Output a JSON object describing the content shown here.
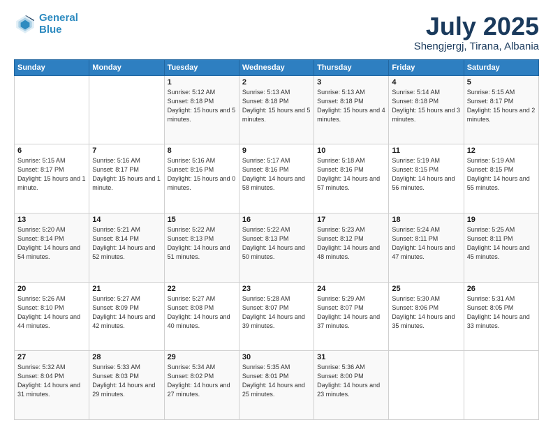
{
  "header": {
    "logo_line1": "General",
    "logo_line2": "Blue",
    "title": "July 2025",
    "subtitle": "Shengjergj, Tirana, Albania"
  },
  "days_of_week": [
    "Sunday",
    "Monday",
    "Tuesday",
    "Wednesday",
    "Thursday",
    "Friday",
    "Saturday"
  ],
  "weeks": [
    [
      {
        "num": "",
        "detail": ""
      },
      {
        "num": "",
        "detail": ""
      },
      {
        "num": "1",
        "detail": "Sunrise: 5:12 AM\nSunset: 8:18 PM\nDaylight: 15 hours and 5 minutes."
      },
      {
        "num": "2",
        "detail": "Sunrise: 5:13 AM\nSunset: 8:18 PM\nDaylight: 15 hours and 5 minutes."
      },
      {
        "num": "3",
        "detail": "Sunrise: 5:13 AM\nSunset: 8:18 PM\nDaylight: 15 hours and 4 minutes."
      },
      {
        "num": "4",
        "detail": "Sunrise: 5:14 AM\nSunset: 8:18 PM\nDaylight: 15 hours and 3 minutes."
      },
      {
        "num": "5",
        "detail": "Sunrise: 5:15 AM\nSunset: 8:17 PM\nDaylight: 15 hours and 2 minutes."
      }
    ],
    [
      {
        "num": "6",
        "detail": "Sunrise: 5:15 AM\nSunset: 8:17 PM\nDaylight: 15 hours and 1 minute."
      },
      {
        "num": "7",
        "detail": "Sunrise: 5:16 AM\nSunset: 8:17 PM\nDaylight: 15 hours and 1 minute."
      },
      {
        "num": "8",
        "detail": "Sunrise: 5:16 AM\nSunset: 8:16 PM\nDaylight: 15 hours and 0 minutes."
      },
      {
        "num": "9",
        "detail": "Sunrise: 5:17 AM\nSunset: 8:16 PM\nDaylight: 14 hours and 58 minutes."
      },
      {
        "num": "10",
        "detail": "Sunrise: 5:18 AM\nSunset: 8:16 PM\nDaylight: 14 hours and 57 minutes."
      },
      {
        "num": "11",
        "detail": "Sunrise: 5:19 AM\nSunset: 8:15 PM\nDaylight: 14 hours and 56 minutes."
      },
      {
        "num": "12",
        "detail": "Sunrise: 5:19 AM\nSunset: 8:15 PM\nDaylight: 14 hours and 55 minutes."
      }
    ],
    [
      {
        "num": "13",
        "detail": "Sunrise: 5:20 AM\nSunset: 8:14 PM\nDaylight: 14 hours and 54 minutes."
      },
      {
        "num": "14",
        "detail": "Sunrise: 5:21 AM\nSunset: 8:14 PM\nDaylight: 14 hours and 52 minutes."
      },
      {
        "num": "15",
        "detail": "Sunrise: 5:22 AM\nSunset: 8:13 PM\nDaylight: 14 hours and 51 minutes."
      },
      {
        "num": "16",
        "detail": "Sunrise: 5:22 AM\nSunset: 8:13 PM\nDaylight: 14 hours and 50 minutes."
      },
      {
        "num": "17",
        "detail": "Sunrise: 5:23 AM\nSunset: 8:12 PM\nDaylight: 14 hours and 48 minutes."
      },
      {
        "num": "18",
        "detail": "Sunrise: 5:24 AM\nSunset: 8:11 PM\nDaylight: 14 hours and 47 minutes."
      },
      {
        "num": "19",
        "detail": "Sunrise: 5:25 AM\nSunset: 8:11 PM\nDaylight: 14 hours and 45 minutes."
      }
    ],
    [
      {
        "num": "20",
        "detail": "Sunrise: 5:26 AM\nSunset: 8:10 PM\nDaylight: 14 hours and 44 minutes."
      },
      {
        "num": "21",
        "detail": "Sunrise: 5:27 AM\nSunset: 8:09 PM\nDaylight: 14 hours and 42 minutes."
      },
      {
        "num": "22",
        "detail": "Sunrise: 5:27 AM\nSunset: 8:08 PM\nDaylight: 14 hours and 40 minutes."
      },
      {
        "num": "23",
        "detail": "Sunrise: 5:28 AM\nSunset: 8:07 PM\nDaylight: 14 hours and 39 minutes."
      },
      {
        "num": "24",
        "detail": "Sunrise: 5:29 AM\nSunset: 8:07 PM\nDaylight: 14 hours and 37 minutes."
      },
      {
        "num": "25",
        "detail": "Sunrise: 5:30 AM\nSunset: 8:06 PM\nDaylight: 14 hours and 35 minutes."
      },
      {
        "num": "26",
        "detail": "Sunrise: 5:31 AM\nSunset: 8:05 PM\nDaylight: 14 hours and 33 minutes."
      }
    ],
    [
      {
        "num": "27",
        "detail": "Sunrise: 5:32 AM\nSunset: 8:04 PM\nDaylight: 14 hours and 31 minutes."
      },
      {
        "num": "28",
        "detail": "Sunrise: 5:33 AM\nSunset: 8:03 PM\nDaylight: 14 hours and 29 minutes."
      },
      {
        "num": "29",
        "detail": "Sunrise: 5:34 AM\nSunset: 8:02 PM\nDaylight: 14 hours and 27 minutes."
      },
      {
        "num": "30",
        "detail": "Sunrise: 5:35 AM\nSunset: 8:01 PM\nDaylight: 14 hours and 25 minutes."
      },
      {
        "num": "31",
        "detail": "Sunrise: 5:36 AM\nSunset: 8:00 PM\nDaylight: 14 hours and 23 minutes."
      },
      {
        "num": "",
        "detail": ""
      },
      {
        "num": "",
        "detail": ""
      }
    ]
  ]
}
